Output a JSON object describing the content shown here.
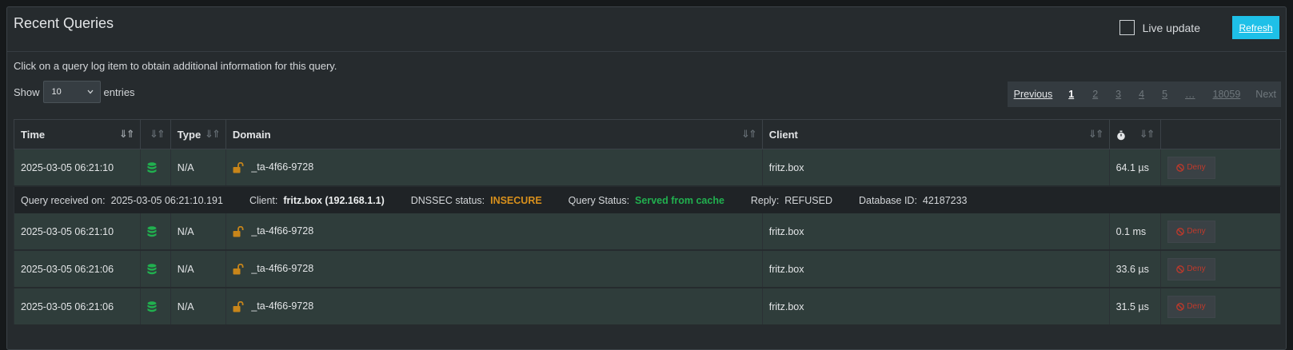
{
  "panel": {
    "title": "Recent Queries",
    "live_update_label": "Live update",
    "refresh_label": "Refresh",
    "info_text": "Click on a query log item to obtain additional information for this query.",
    "show_label": "Show",
    "entries_value": "10",
    "entries_label": "entries"
  },
  "pagination": {
    "previous": "Previous",
    "pages": [
      "1",
      "2",
      "3",
      "4",
      "5",
      "…",
      "18059"
    ],
    "next": "Next"
  },
  "table": {
    "headers": {
      "time": "Time",
      "type": "Type",
      "domain": "Domain",
      "client": "Client"
    },
    "rows": [
      {
        "time": "2025-03-05 06:21:10",
        "type": "N/A",
        "domain": "_ta-4f66-9728",
        "client": "fritz.box",
        "duration": "64.1 µs",
        "action": "Deny"
      },
      {
        "time": "2025-03-05 06:21:10",
        "type": "N/A",
        "domain": "_ta-4f66-9728",
        "client": "fritz.box",
        "duration": "0.1 ms",
        "action": "Deny"
      },
      {
        "time": "2025-03-05 06:21:06",
        "type": "N/A",
        "domain": "_ta-4f66-9728",
        "client": "fritz.box",
        "duration": "33.6 µs",
        "action": "Deny"
      },
      {
        "time": "2025-03-05 06:21:06",
        "type": "N/A",
        "domain": "_ta-4f66-9728",
        "client": "fritz.box",
        "duration": "31.5 µs",
        "action": "Deny"
      }
    ],
    "detail": {
      "received_label": "Query received on:",
      "received_value": "2025-03-05 06:21:10.191",
      "client_label": "Client:",
      "client_value": "fritz.box (192.168.1.1)",
      "dnssec_label": "DNSSEC status:",
      "dnssec_value": "INSECURE",
      "status_label": "Query Status:",
      "status_value": "Served from cache",
      "reply_label": "Reply:",
      "reply_value": "REFUSED",
      "dbid_label": "Database ID:",
      "dbid_value": "42187233"
    }
  },
  "colors": {
    "accent": "#1ec0e8",
    "cached_green": "#21b04f",
    "insecure_orange": "#d8901c",
    "deny_red": "#c0392b",
    "lock_orange": "#c8851a"
  },
  "icons": [
    "database-icon",
    "unlock-icon",
    "ban-icon",
    "stopwatch-icon",
    "sort-icon",
    "chevron-down-icon"
  ]
}
